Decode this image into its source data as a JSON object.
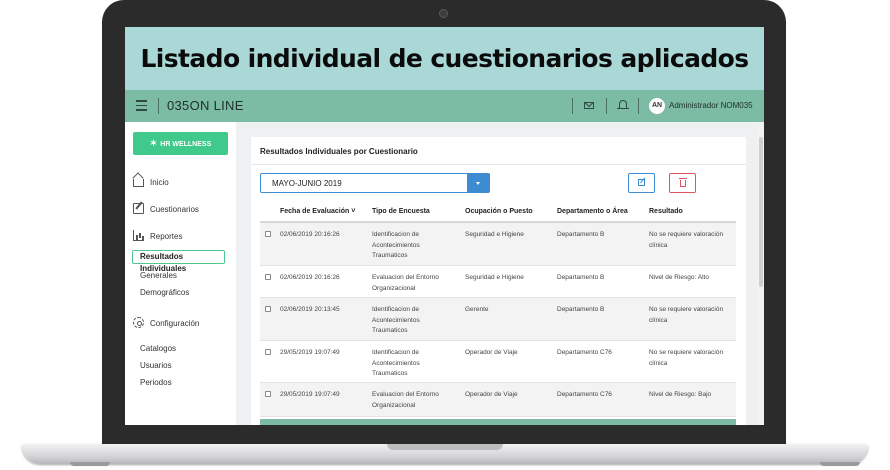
{
  "banner": {
    "title": "Listado individual de cuestionarios aplicados"
  },
  "topbar": {
    "app_name": "035ON LINE",
    "avatar_initials": "AN",
    "user_name": "Administrador NOM035"
  },
  "sidebar": {
    "brand_button": "HR WELLNESS",
    "items": [
      {
        "label": "Inicio",
        "icon": "home-icon"
      },
      {
        "label": "Cuestionarios",
        "icon": "edit-icon"
      },
      {
        "label": "Reportes",
        "icon": "chart-icon"
      }
    ],
    "reportes_sub": [
      {
        "label": "Resultados Individuales",
        "active": true
      },
      {
        "label": "Generales"
      },
      {
        "label": "Demográficos"
      }
    ],
    "config": {
      "label": "Configuración",
      "icon": "gear-icon"
    },
    "config_sub": [
      {
        "label": "Catalogos"
      },
      {
        "label": "Usuarios"
      },
      {
        "label": "Periodos"
      }
    ]
  },
  "card": {
    "title": "Resultados Individuales por Cuestionario",
    "select_value": "MAYO-JUNIO 2019",
    "accent_blue": "#3d8bd0",
    "accent_red": "#e05462"
  },
  "table": {
    "headers": {
      "fecha": "Fecha de Evaluación",
      "tipo": "Tipo de Encuesta",
      "ocupacion": "Ocupación o Puesto",
      "departamento": "Departamento o Área",
      "resultado": "Resultado"
    },
    "rows": [
      {
        "fecha": "02/06/2019 20:16:26",
        "tipo": "Identificacion de Acontecimientos Traumaticos",
        "ocupacion": "Seguridad e Higiene",
        "departamento": "Departamento B",
        "resultado": "No se requiere valoración clínica"
      },
      {
        "fecha": "02/06/2019 20:16:26",
        "tipo": "Evaluacion del Entorno Organizacional",
        "ocupacion": "Seguridad e Higiene",
        "departamento": "Departamento B",
        "resultado": "Nivel de Riesgo: Alto"
      },
      {
        "fecha": "02/06/2019 20:13:45",
        "tipo": "Identificacion de Acontecimientos Traumaticos",
        "ocupacion": "Gerente",
        "departamento": "Departamento B",
        "resultado": "No se requiere valoración clínica"
      },
      {
        "fecha": "29/05/2019 19:07:49",
        "tipo": "Identificacion de Acontecimientos Traumaticos",
        "ocupacion": "Operador de Viaje",
        "departamento": "Departamento C76",
        "resultado": "No se requiere valoración clínica"
      },
      {
        "fecha": "29/05/2019 19:07:49",
        "tipo": "Evaluacion del Entorno Organizacional",
        "ocupacion": "Operador de Viaje",
        "departamento": "Departamento C76",
        "resultado": "Nivel de Riesgo: Bajo"
      }
    ]
  }
}
